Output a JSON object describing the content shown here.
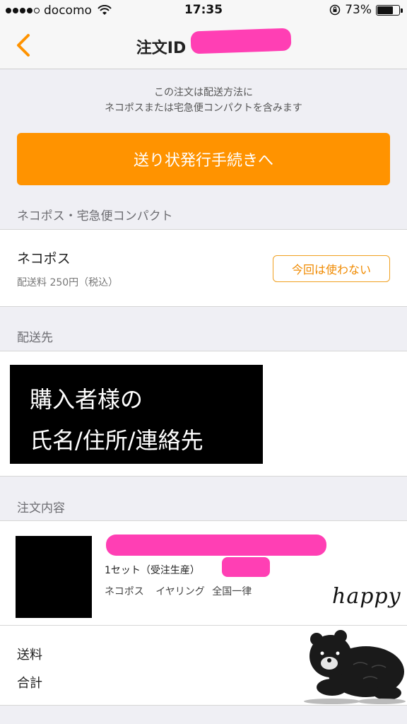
{
  "status_bar": {
    "carrier": "docomo",
    "time": "17:35",
    "battery": "73%"
  },
  "nav": {
    "title": "注文ID",
    "back_icon": "chevron-left-icon"
  },
  "notice": {
    "line1": "この注文は配送方法に",
    "line2": "ネコポスまたは宅急便コンパクトを含みます"
  },
  "primary_button": {
    "label": "送り状発行手続きへ"
  },
  "shipping_section": {
    "header": "ネコポス・宅急便コンパクト",
    "method_name": "ネコポス",
    "fee": "配送料 250円（税込）",
    "skip_label": "今回は使わない"
  },
  "destination_section": {
    "header": "配送先",
    "overlay_line1": "購入者様の",
    "overlay_line2": "氏名/住所/連絡先"
  },
  "order_section": {
    "header": "注文内容",
    "item_qty": "1セット（受注生産）",
    "item_shipping": "ネコポス",
    "item_category": "イヤリング",
    "item_region": "全国一律"
  },
  "summary": {
    "shipping_label": "送料",
    "total_label": "合計"
  },
  "decoration": {
    "handwritten": "happy"
  },
  "colors": {
    "accent": "#ff9300",
    "redaction": "#ff3fb4",
    "background": "#efeff4"
  }
}
